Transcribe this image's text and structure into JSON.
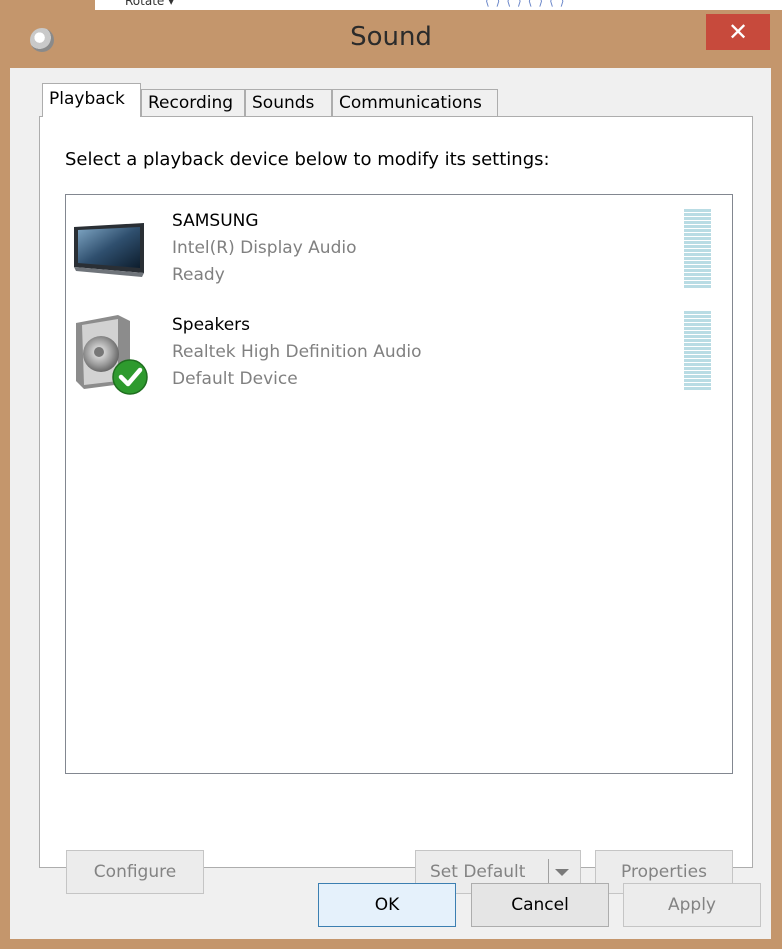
{
  "window": {
    "title": "Sound",
    "close_label": "✕"
  },
  "background_app": {
    "text": "Rotate ▾",
    "marks": "⟨⟩⟨⟩⟨⟩⟨⟩"
  },
  "tabs": [
    {
      "label": "Playback",
      "active": true
    },
    {
      "label": "Recording",
      "active": false
    },
    {
      "label": "Sounds",
      "active": false
    },
    {
      "label": "Communications",
      "active": false
    }
  ],
  "instruction": "Select a playback device below to modify its settings:",
  "devices": [
    {
      "icon": "monitor-icon",
      "name": "SAMSUNG",
      "driver": "Intel(R) Display Audio",
      "status": "Ready",
      "default": false
    },
    {
      "icon": "speaker-icon",
      "name": "Speakers",
      "driver": "Realtek High Definition Audio",
      "status": "Default Device",
      "default": true
    }
  ],
  "panel_buttons": {
    "configure": "Configure",
    "set_default": "Set Default",
    "properties": "Properties"
  },
  "dialog_buttons": {
    "ok": "OK",
    "cancel": "Cancel",
    "apply": "Apply"
  },
  "colors": {
    "frame": "#c4966c",
    "close": "#c74a3c",
    "meter": "#b9dce4",
    "default_check": "#2e9a2e"
  }
}
